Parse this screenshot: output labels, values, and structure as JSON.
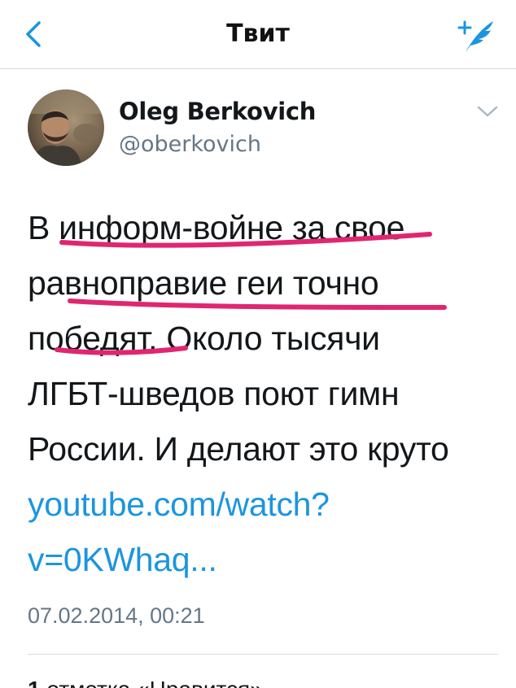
{
  "navbar": {
    "title": "Твит",
    "back_icon": "chevron-left-icon",
    "compose_icon": "compose-tweet-icon",
    "accent_color": "#1b95e0"
  },
  "author": {
    "name": "Oleg Berkovich",
    "handle": "@oberkovich",
    "menu_icon": "chevron-down-icon"
  },
  "tweet": {
    "lines": [
      "В информ-войне за свое",
      "равноправие геи точно",
      "победят. Около тысячи",
      "ЛГБТ-шведов поют гимн",
      "России. И делают это круто"
    ],
    "link_lines": [
      "youtube.com/watch?",
      "v=0KWhaq..."
    ],
    "timestamp": "07.02.2014, 00:21",
    "annotation_color": "#e0266f"
  },
  "stats": {
    "count": "1",
    "rest": " отметка «Нравится»"
  }
}
